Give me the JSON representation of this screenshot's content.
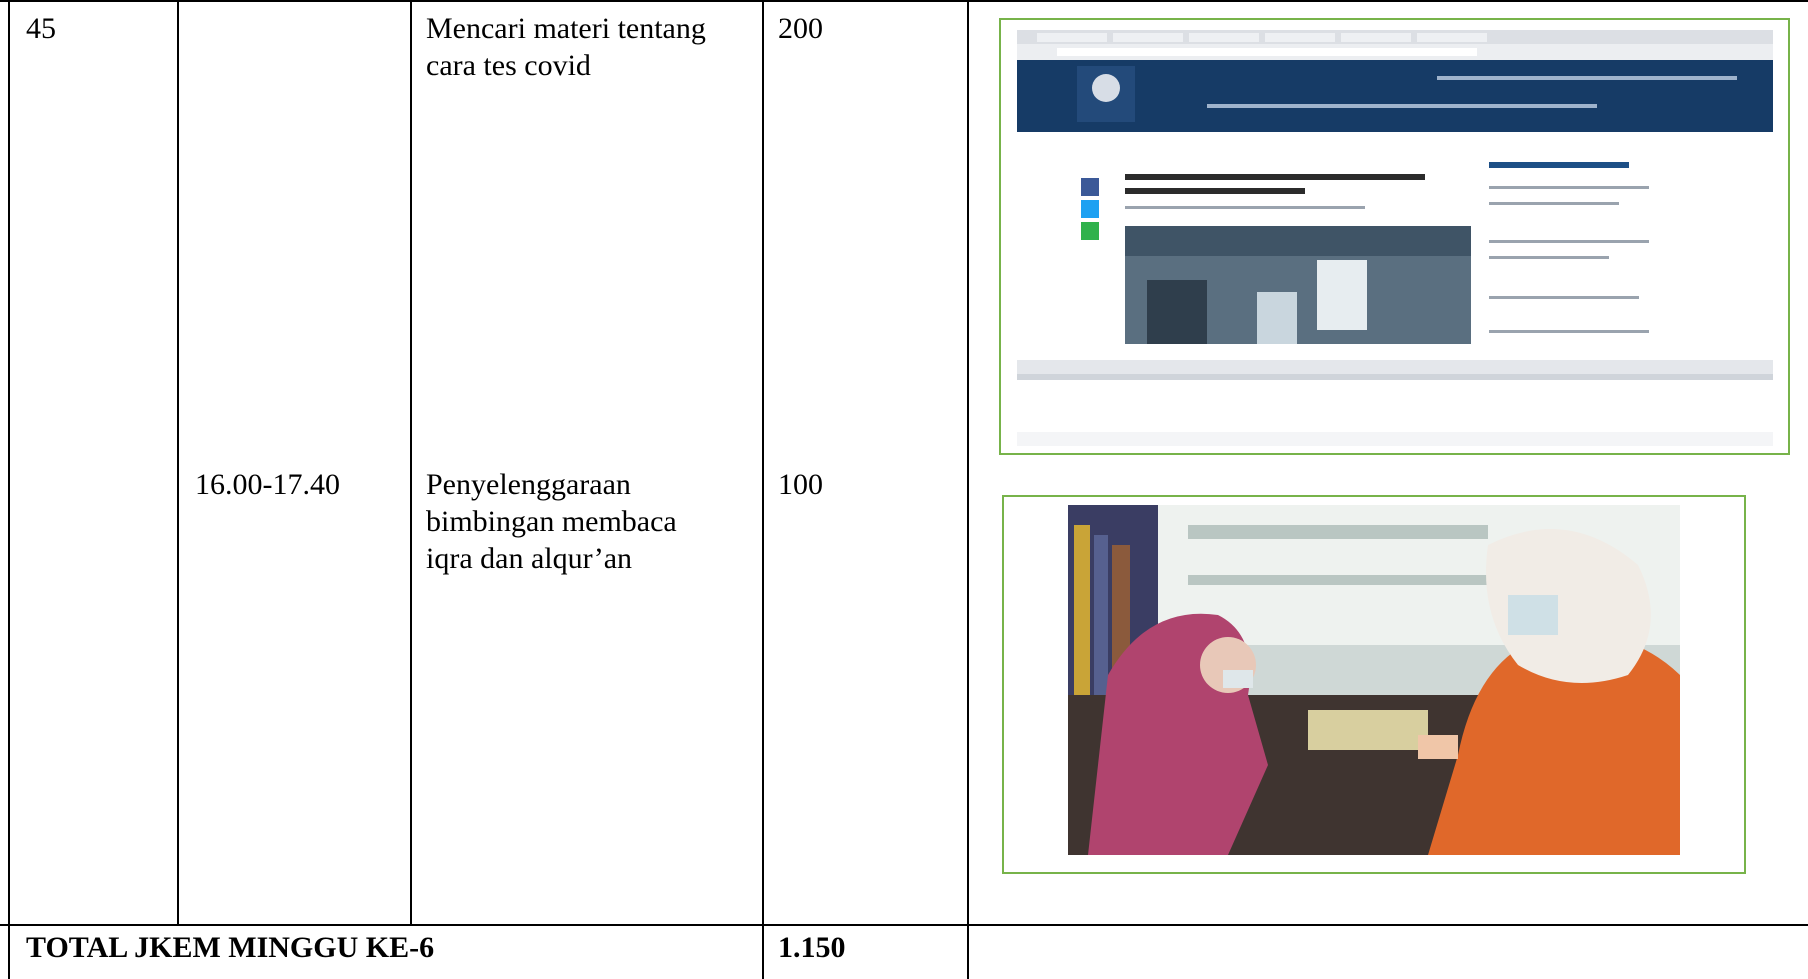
{
  "table": {
    "row": {
      "number": "45",
      "entries": [
        {
          "time": "",
          "activity": "Mencari materi tentang\ncara tes covid",
          "jkem": "200"
        },
        {
          "time": "16.00-17.40",
          "activity": "Penyelenggaraan\nbimbingan membaca\niqra dan alqur’an",
          "jkem": "100"
        }
      ]
    },
    "total": {
      "label": "TOTAL JKEM MINGGU KE-6",
      "value": "1.150"
    }
  },
  "photos": [
    {
      "icon": "webpage-screenshot",
      "frame_color": "#77b34a"
    },
    {
      "icon": "reading-session-photo",
      "frame_color": "#77b34a"
    }
  ]
}
